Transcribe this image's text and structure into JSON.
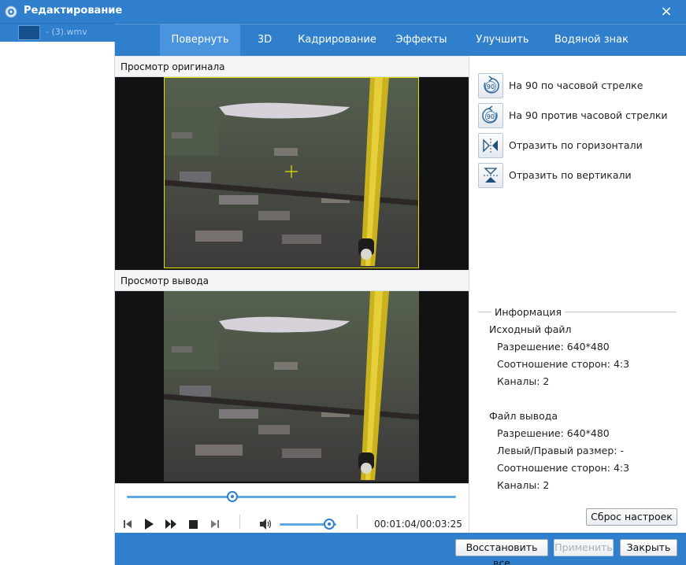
{
  "window": {
    "title": "Редактирование",
    "close_icon": "×"
  },
  "sidebar": {
    "files": [
      {
        "name": "- (3).wmv"
      }
    ]
  },
  "tabs": [
    {
      "label": "Повернуть",
      "active": true
    },
    {
      "label": "3D",
      "active": false
    },
    {
      "label": "Кадрирование",
      "active": false
    },
    {
      "label": "Эффекты",
      "active": false
    },
    {
      "label": "Улучшить",
      "active": false
    },
    {
      "label": "Водяной знак",
      "active": false
    }
  ],
  "preview": {
    "original_label": "Просмотр оригинала",
    "output_label": "Просмотр вывода"
  },
  "player": {
    "seek_fraction": 0.32,
    "volume_fraction": 0.88,
    "time": "00:01:04/00:03:25"
  },
  "rotate_actions": [
    {
      "label": "На 90 по часовой стрелке",
      "icon": "rotate-clockwise-icon"
    },
    {
      "label": "На 90 против часовой стрелки",
      "icon": "rotate-counterclockwise-icon"
    },
    {
      "label": "Отразить по горизонтали",
      "icon": "flip-horizontal-icon"
    },
    {
      "label": "Отразить по вертикали",
      "icon": "flip-vertical-icon"
    }
  ],
  "info": {
    "legend": "Информация",
    "source": {
      "heading": "Исходный файл",
      "resolution": "Разрешение: 640*480",
      "aspect": "Соотношение сторон: 4:3",
      "channels": "Каналы: 2"
    },
    "output": {
      "heading": "Файл вывода",
      "resolution": "Разрешение: 640*480",
      "lr_size": "Левый/Правый размер: -",
      "aspect": "Соотношение сторон: 4:3",
      "channels": "Каналы: 2"
    }
  },
  "buttons": {
    "reset": "Сброс настроек",
    "restore_all": "Восстановить все",
    "apply": "Применить",
    "close": "Закрыть"
  },
  "colors": {
    "accent": "#2f7fcd",
    "crop_frame": "#e3e000"
  }
}
